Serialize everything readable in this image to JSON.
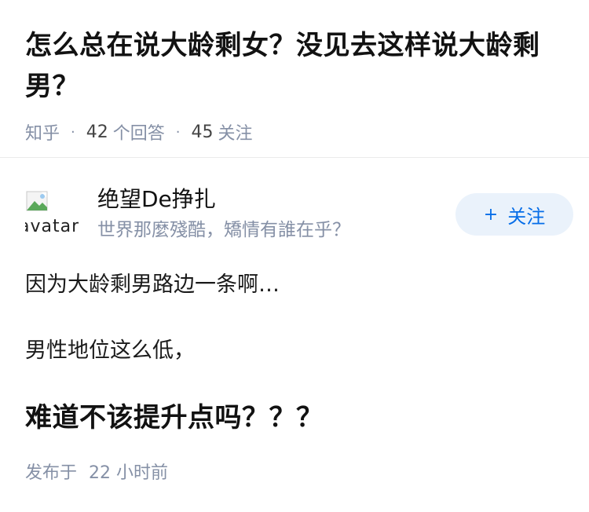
{
  "question": {
    "title": "怎么总在说大龄剩女？没见去这样说大龄剩男？",
    "source": "知乎",
    "answers_count": "42",
    "answers_label": "个回答",
    "followers_count": "45",
    "followers_label": "关注"
  },
  "author": {
    "avatar_alt": "avatar",
    "name": "绝望De挣扎",
    "bio": "世界那麼殘酷，矯情有誰在乎？",
    "follow_icon": "+",
    "follow_label": "关注"
  },
  "answer": {
    "paragraphs": [
      "因为大龄剩男路边一条啊…",
      "男性地位这么低，",
      "难道不该提升点吗？？？"
    ],
    "published_label": "发布于",
    "published_time": "22 小时前"
  },
  "colors": {
    "accent": "#056de8",
    "follow_bg": "#eaf2fb",
    "meta": "#8590a6",
    "divider": "#ebebeb"
  },
  "icons": {
    "avatar": "broken-image-icon"
  }
}
